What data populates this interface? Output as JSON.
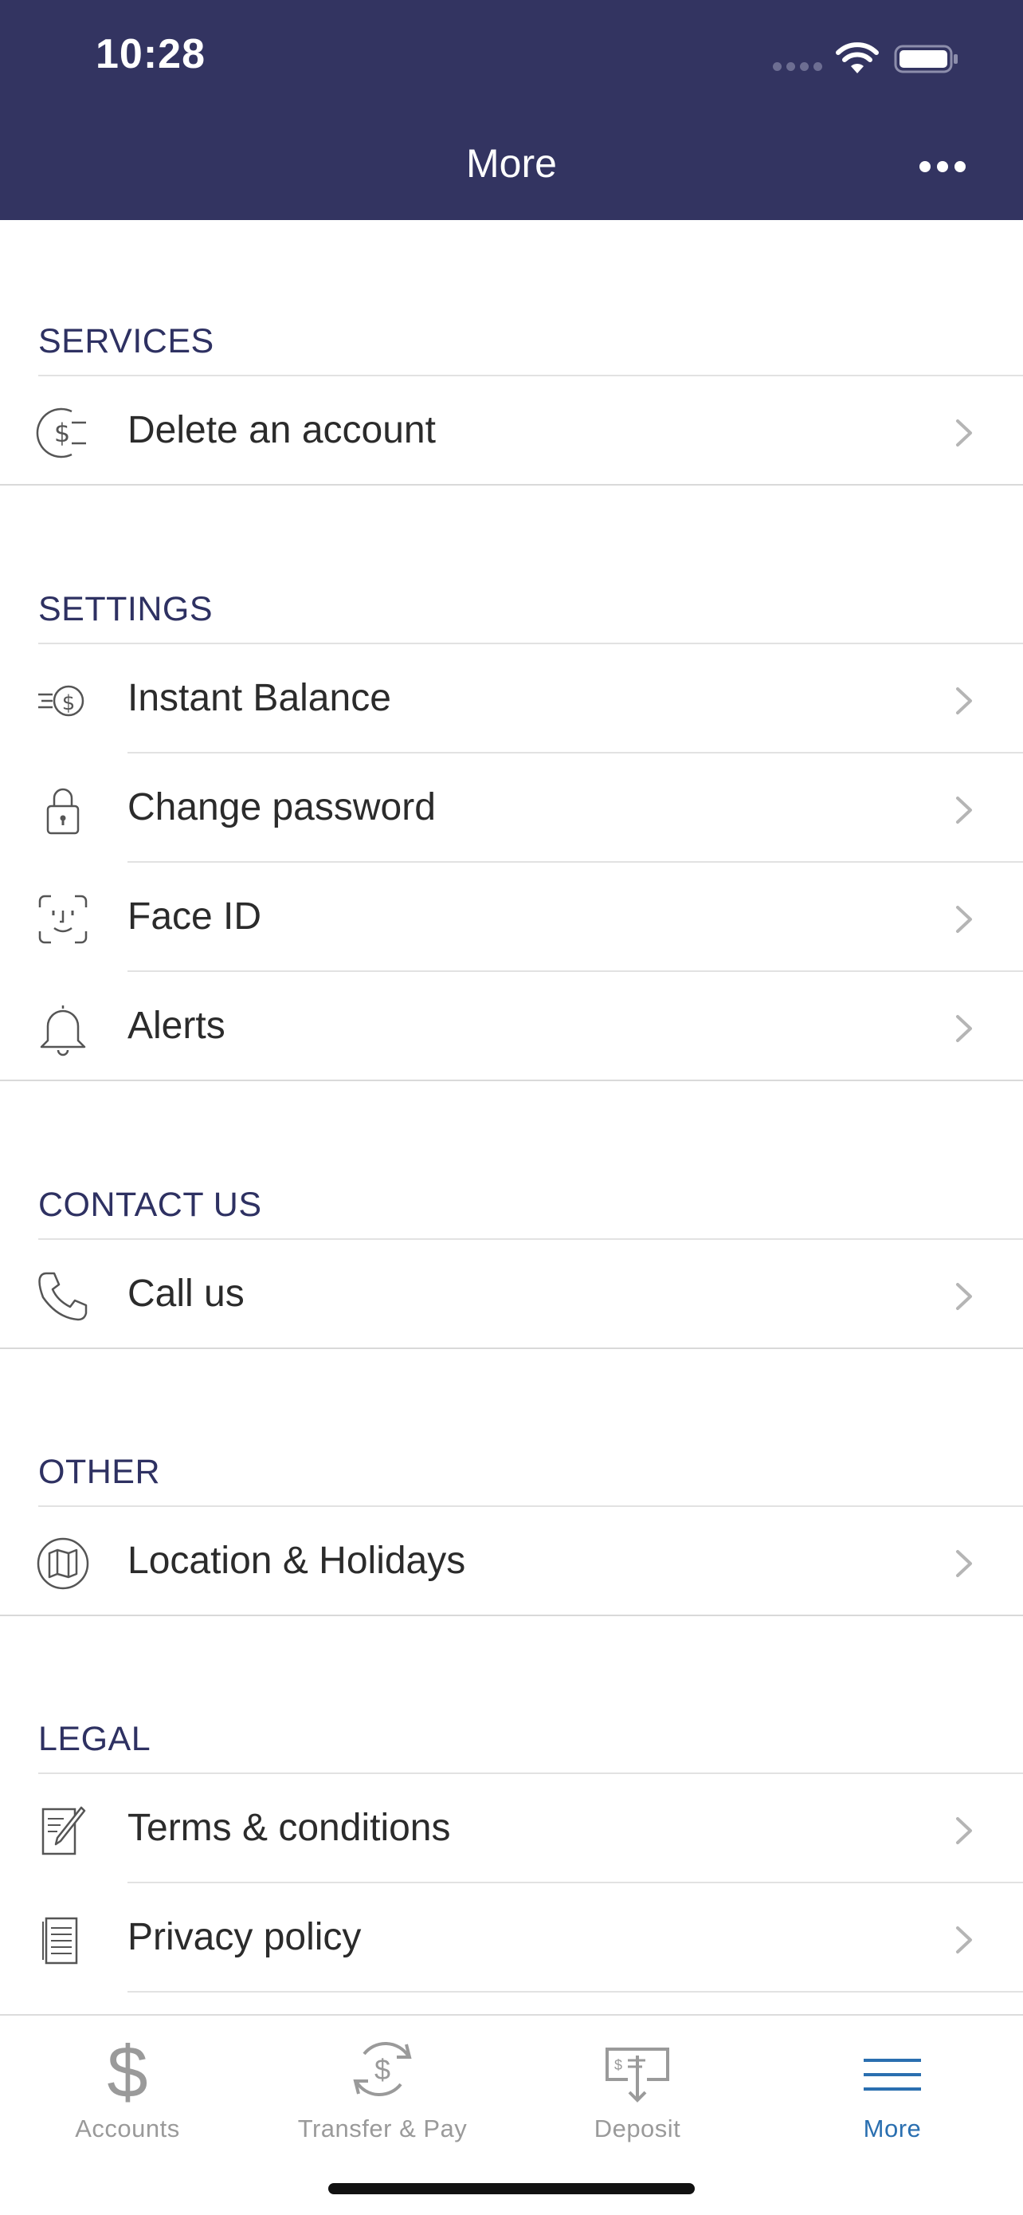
{
  "status_bar": {
    "time": "10:28"
  },
  "header": {
    "title": "More"
  },
  "sections": {
    "services": {
      "title": "SERVICES",
      "items": [
        {
          "label": "Delete an account",
          "icon": "dollar-circle-icon"
        }
      ]
    },
    "settings": {
      "title": "SETTINGS",
      "items": [
        {
          "label": "Instant Balance",
          "icon": "instant-balance-icon"
        },
        {
          "label": "Change password",
          "icon": "lock-icon"
        },
        {
          "label": "Face ID",
          "icon": "face-id-icon"
        },
        {
          "label": "Alerts",
          "icon": "bell-icon"
        }
      ]
    },
    "contact": {
      "title": "CONTACT US",
      "items": [
        {
          "label": "Call us",
          "icon": "phone-icon"
        }
      ]
    },
    "other": {
      "title": "OTHER",
      "items": [
        {
          "label": "Location & Holidays",
          "icon": "map-icon"
        }
      ]
    },
    "legal": {
      "title": "LEGAL",
      "items": [
        {
          "label": "Terms & conditions",
          "icon": "document-pen-icon"
        },
        {
          "label": "Privacy policy",
          "icon": "document-icon"
        }
      ]
    }
  },
  "tabbar": {
    "tabs": [
      {
        "label": "Accounts",
        "icon": "dollar-icon",
        "active": false
      },
      {
        "label": "Transfer & Pay",
        "icon": "transfer-icon",
        "active": false
      },
      {
        "label": "Deposit",
        "icon": "check-deposit-icon",
        "active": false
      },
      {
        "label": "More",
        "icon": "menu-icon",
        "active": true
      }
    ]
  },
  "colors": {
    "header_bg": "#333461",
    "section_title": "#2e3162",
    "active_tab": "#2a6fb0",
    "inactive_tab": "#9a9a9a"
  }
}
